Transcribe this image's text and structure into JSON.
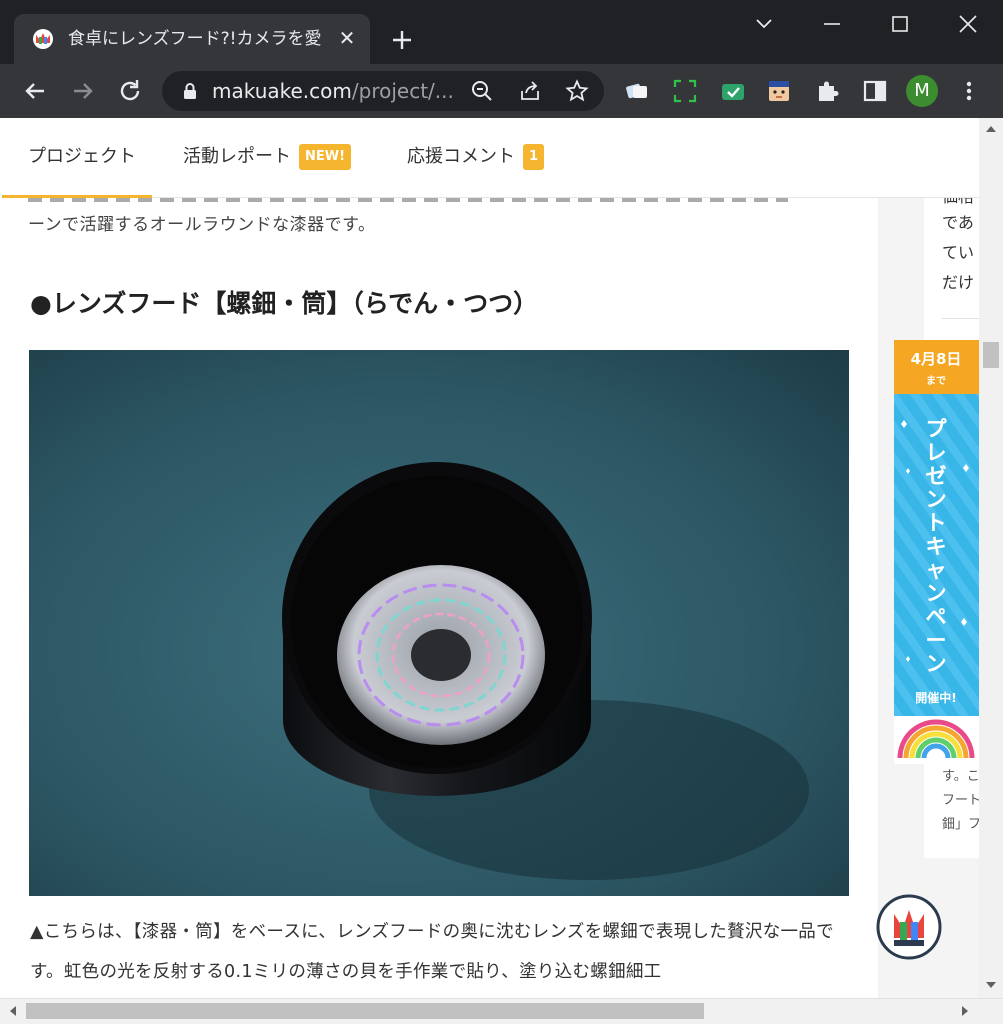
{
  "browser": {
    "tab_title": "食卓にレンズフード?!カメラを愛",
    "tab_close": "✕",
    "url_host": "makuake.com",
    "url_path": "/project/...",
    "profile_initial": "M",
    "colors": {
      "frame": "#202124",
      "toolbar": "#35363a",
      "avatar": "#3c8d2f"
    }
  },
  "page_nav": {
    "items": [
      {
        "label": "プロジェクト"
      },
      {
        "label": "活動レポート",
        "badge": "NEW!"
      },
      {
        "label": "応援コメント",
        "badge": "1"
      }
    ],
    "accent_color": "#f5b52e"
  },
  "article": {
    "top_text": "ーンで活躍するオールラウンドな漆器です。",
    "heading": "●レンズフード【螺鈿・筒】（らでん・つつ）",
    "caption": "▲こちらは、【漆器・筒】をベースに、レンズフードの奥に沈むレンズを螺鈿で表現した贅沢な一品です。虹色の光を反射する0.1ミリの薄さの貝を手作業で貼り、塗り込む螺鈿細工"
  },
  "sidebar": {
    "top_lines": [
      "価格",
      "であ",
      "てい",
      "だけ"
    ],
    "bottom_lines": [
      "す。こ",
      "フート",
      "鈿」フ"
    ]
  },
  "banner": {
    "date": "4月8日",
    "until": "まで",
    "title_chars": [
      "プ",
      "レ",
      "ゼ",
      "ン",
      "ト",
      "キ",
      "ャ",
      "ン",
      "ペ",
      "ー",
      "ン"
    ],
    "sub": "開催中!",
    "colors": {
      "top": "#f5a623",
      "body": "#38b6e8"
    }
  }
}
